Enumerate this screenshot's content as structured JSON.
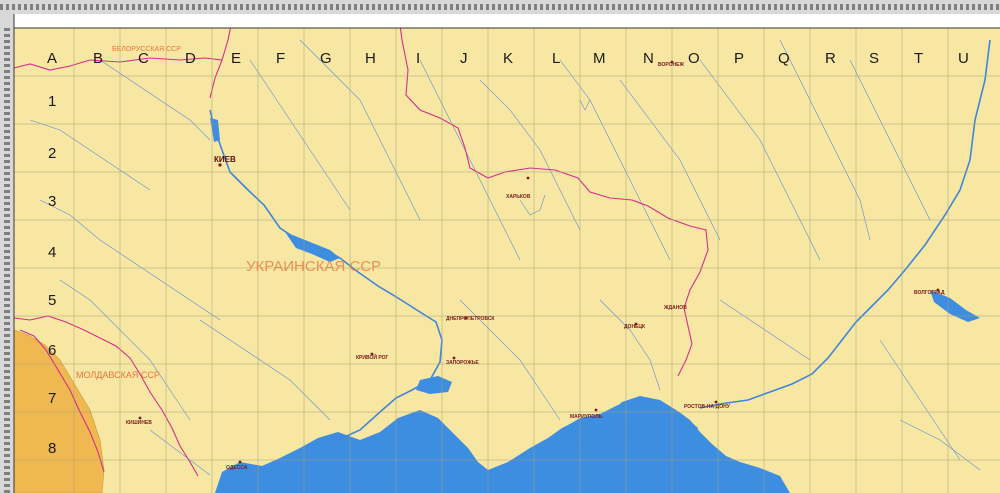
{
  "columns": [
    "A",
    "B",
    "C",
    "D",
    "E",
    "F",
    "G",
    "H",
    "I",
    "J",
    "K",
    "L",
    "M",
    "N",
    "O",
    "P",
    "Q",
    "R",
    "S",
    "T",
    "U"
  ],
  "rows": [
    "1",
    "2",
    "3",
    "4",
    "5",
    "6",
    "7",
    "8"
  ],
  "regions": {
    "belarus": "БЕЛОРУССКАЯ ССР",
    "ukraine": "УКРАИНСКАЯ ССР",
    "moldova": "МОЛДАВСКАЯ ССР"
  },
  "cities": {
    "kiev": "КИЕВ",
    "kharkov": "ХАРЬКОВ",
    "dnepropetrovsk": "ДНЕПРОПЕТРОВСК",
    "zaporozhye": "ЗАПОРОЖЬЕ",
    "krivoy_rog": "КРИВОЙ РОГ",
    "donetsk": "ДОНЕЦК",
    "zhdanov": "ЖДАНОВ",
    "mariupol": "МАРИУПОЛЬ",
    "rostov": "РОСТОВ-НА-ДОНУ",
    "odessa": "ОДЕССА",
    "kishinev": "КИШИНЕВ",
    "voronezh": "ВОРОНЕЖ",
    "volgograd": "ВОЛГОГРАД"
  },
  "colors": {
    "land": "#f7e7a3",
    "sea": "#3d8de0",
    "romania": "#f0b850",
    "border": "#d62f8a",
    "river": "#5f8fd6",
    "grid": "#a6a07a"
  }
}
